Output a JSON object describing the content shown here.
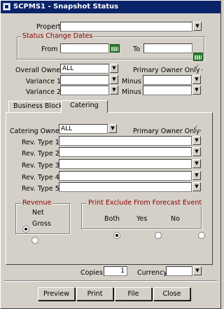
{
  "window": {
    "title": "SCPMS1 - Snapshot Status"
  },
  "filters": {
    "property_label": "Property",
    "property_value": "",
    "status_change_dates": {
      "title": "Status Change Dates",
      "from_label": "From",
      "to_label": "To",
      "from_value": "",
      "to_value": ""
    },
    "overall_owner_label": "Overall Owner",
    "overall_owner_value": "ALL",
    "primary_owner_only_label": "Primary Owner Only",
    "variance1_label": "Variance 1",
    "variance2_label": "Variance 2",
    "minus_label": "Minus"
  },
  "tabs": [
    {
      "label": "Business Block"
    },
    {
      "label": "Catering"
    }
  ],
  "catering": {
    "catering_owner_label": "Catering Owner",
    "catering_owner_value": "ALL",
    "primary_owner_only_label": "Primary Owner Only",
    "rev_types": [
      {
        "label": "Rev. Type 1",
        "value": ""
      },
      {
        "label": "Rev. Type 2",
        "value": ""
      },
      {
        "label": "Rev. Type 3",
        "value": ""
      },
      {
        "label": "Rev. Type 4",
        "value": ""
      },
      {
        "label": "Rev. Type 5",
        "value": ""
      }
    ],
    "revenue": {
      "title": "Revenue",
      "options": [
        "Net",
        "Gross"
      ],
      "selected": "Net"
    },
    "print_exclude": {
      "title": "Print Exclude From Forecast Event",
      "options": [
        "Both",
        "Yes",
        "No"
      ],
      "selected": "Both"
    }
  },
  "output": {
    "copies_label": "Copies",
    "copies_value": "1",
    "currency_label": "Currency",
    "currency_value": ""
  },
  "buttons": {
    "preview": "Preview",
    "print": "Print",
    "file": "File",
    "close": "Close"
  },
  "icons": {
    "dropdown": "chevron-down-icon",
    "calendar": "calendar-icon",
    "check": "checkmark-icon"
  }
}
